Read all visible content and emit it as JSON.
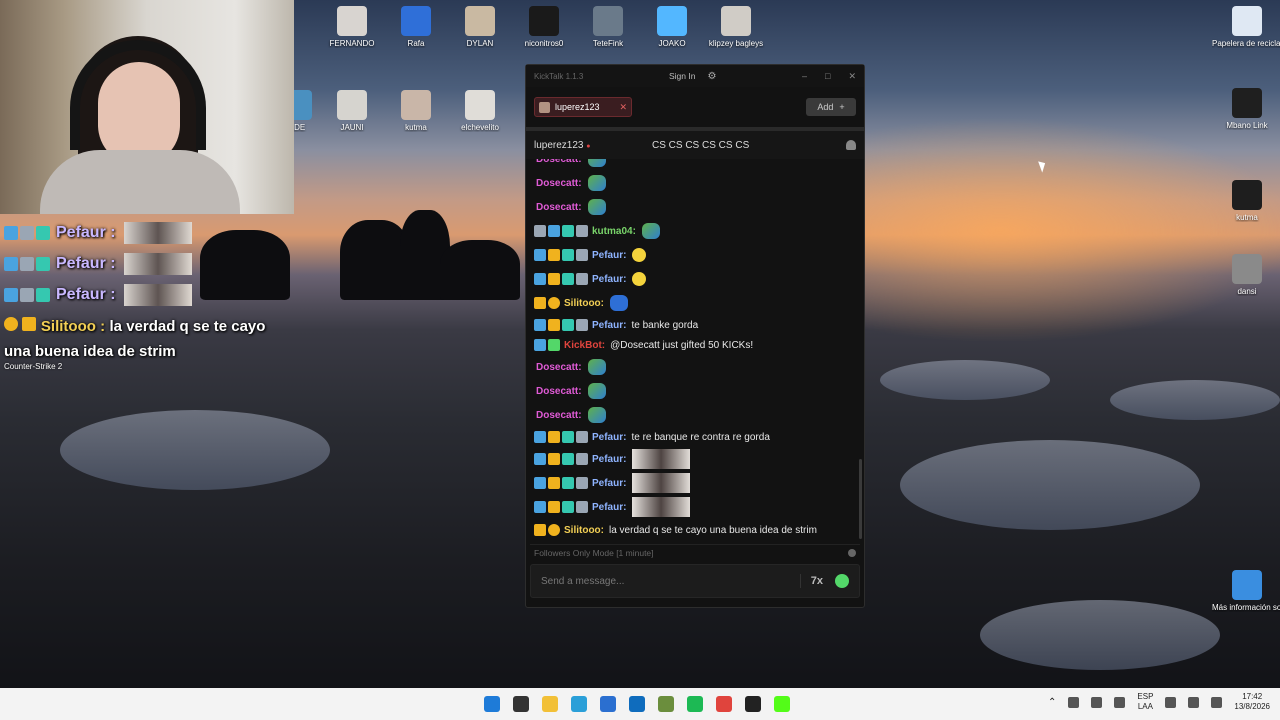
{
  "desktop": {
    "icons_top": [
      {
        "label": "FERNANDO",
        "color": "#d8d4d0"
      },
      {
        "label": "Rafa",
        "color": "#2f6fd8"
      },
      {
        "label": "DYLAN",
        "color": "#c9b9a2"
      },
      {
        "label": "niconitros0",
        "color": "#1a1a1a"
      },
      {
        "label": "TeteFink",
        "color": "#6a7a8a"
      },
      {
        "label": "JOAKO",
        "color": "#53b7ff"
      },
      {
        "label": "klipzey bagleys",
        "color": "#d0ccc6"
      }
    ],
    "icons_second": [
      {
        "label": "KDE",
        "color": "#4a90c0"
      },
      {
        "label": "JAUNI",
        "color": "#d6d4cf"
      },
      {
        "label": "kutma",
        "color": "#c9b6a8"
      },
      {
        "label": "elchevelito",
        "color": "#e0ddd8"
      }
    ],
    "icons_right": [
      {
        "label": "Papelera de reciclaje",
        "color": "#dfe8f3"
      },
      {
        "label": "Mbano Link",
        "color": "#1f1f1f"
      },
      {
        "label": "kutma",
        "color": "#1e1e1e"
      },
      {
        "label": "dansi",
        "color": "#8a8a8a"
      },
      {
        "label": "Más información sobre esta ima...",
        "color": "#3a8ee0"
      }
    ]
  },
  "stream_overlay": {
    "rows": [
      {
        "name": "Pefaur :"
      },
      {
        "name": "Pefaur :"
      },
      {
        "name": "Pefaur :"
      }
    ],
    "last_name": "Silitooo :",
    "last_message": "la verdad q se te cayo una buena idea de strim",
    "game_label": "Counter-Strike 2"
  },
  "kicktalk": {
    "app_title": "KickTalk 1.1.3",
    "sign_in": "Sign In",
    "tab_name": "luperez123",
    "add_label": "Add",
    "channel": "luperez123",
    "stream_title": "CS CS CS CS CS CS",
    "followers_mode": "Followers Only Mode [1 minute]",
    "input_placeholder": "Send a message...",
    "messages": [
      {
        "user": "Dosecatt:",
        "color": "pink",
        "badges": [],
        "text": "",
        "emote": "frog"
      },
      {
        "user": "Dosecatt:",
        "color": "pink",
        "badges": [],
        "text": "",
        "emote": "frog"
      },
      {
        "user": "Dosecatt:",
        "color": "pink",
        "badges": [],
        "text": "",
        "emote": "frog"
      },
      {
        "user": "kutma04:",
        "color": "green",
        "badges": [
          "gray",
          "blue",
          "teal",
          "gray"
        ],
        "text": "",
        "emote": "frog"
      },
      {
        "user": "Pefaur:",
        "color": "blue",
        "badges": [
          "blue",
          "gold",
          "teal",
          "gray"
        ],
        "text": "",
        "emote": "smile"
      },
      {
        "user": "Pefaur:",
        "color": "blue",
        "badges": [
          "blue",
          "gold",
          "teal",
          "gray"
        ],
        "text": "",
        "emote": "smile"
      },
      {
        "user": "Silitooo:",
        "color": "yellow",
        "badges": [
          "gold",
          "ring"
        ],
        "text": "",
        "emote": "blue"
      },
      {
        "user": "Pefaur:",
        "color": "blue",
        "badges": [
          "blue",
          "gold",
          "teal",
          "gray"
        ],
        "text": "te banke gorda",
        "emote": ""
      },
      {
        "user": "KickBot:",
        "color": "red",
        "badges": [
          "blue",
          "green"
        ],
        "text": "@Dosecatt just gifted 50 KICKs!",
        "emote": ""
      },
      {
        "user": "Dosecatt:",
        "color": "pink",
        "badges": [],
        "text": "",
        "emote": "frog"
      },
      {
        "user": "Dosecatt:",
        "color": "pink",
        "badges": [],
        "text": "",
        "emote": "frog"
      },
      {
        "user": "Dosecatt:",
        "color": "pink",
        "badges": [],
        "text": "",
        "emote": "frog"
      },
      {
        "user": "Pefaur:",
        "color": "blue",
        "badges": [
          "blue",
          "gold",
          "teal",
          "gray"
        ],
        "text": "te re banque re contra re gorda",
        "emote": ""
      },
      {
        "user": "Pefaur:",
        "color": "blue",
        "badges": [
          "blue",
          "gold",
          "teal",
          "gray"
        ],
        "text": "",
        "emote": "pic"
      },
      {
        "user": "Pefaur:",
        "color": "blue",
        "badges": [
          "blue",
          "gold",
          "teal",
          "gray"
        ],
        "text": "",
        "emote": "pic"
      },
      {
        "user": "Pefaur:",
        "color": "blue",
        "badges": [
          "blue",
          "gold",
          "teal",
          "gray"
        ],
        "text": "",
        "emote": "pic"
      },
      {
        "user": "Silitooo:",
        "color": "yellow",
        "badges": [
          "gold",
          "ring"
        ],
        "text": "la verdad q se te cayo una buena idea de strim",
        "emote": ""
      }
    ]
  },
  "taskbar": {
    "apps": [
      {
        "name": "windows-start-icon",
        "color": "#1e7bd8"
      },
      {
        "name": "search-icon",
        "color": "#333333"
      },
      {
        "name": "file-explorer-icon",
        "color": "#f2c037"
      },
      {
        "name": "edge-icon",
        "color": "#2a9fd8"
      },
      {
        "name": "store-icon",
        "color": "#2b6fd0"
      },
      {
        "name": "outlook-icon",
        "color": "#0f6cbd"
      },
      {
        "name": "minecraft-icon",
        "color": "#6b8e3d"
      },
      {
        "name": "spotify-icon",
        "color": "#1db954"
      },
      {
        "name": "chrome-icon",
        "color": "#e0443d"
      },
      {
        "name": "obs-icon",
        "color": "#222222"
      },
      {
        "name": "kick-icon",
        "color": "#53fc18"
      }
    ],
    "lang_top": "ESP",
    "lang_bottom": "LAA",
    "time": "17:42",
    "date": "13/8/2026"
  }
}
